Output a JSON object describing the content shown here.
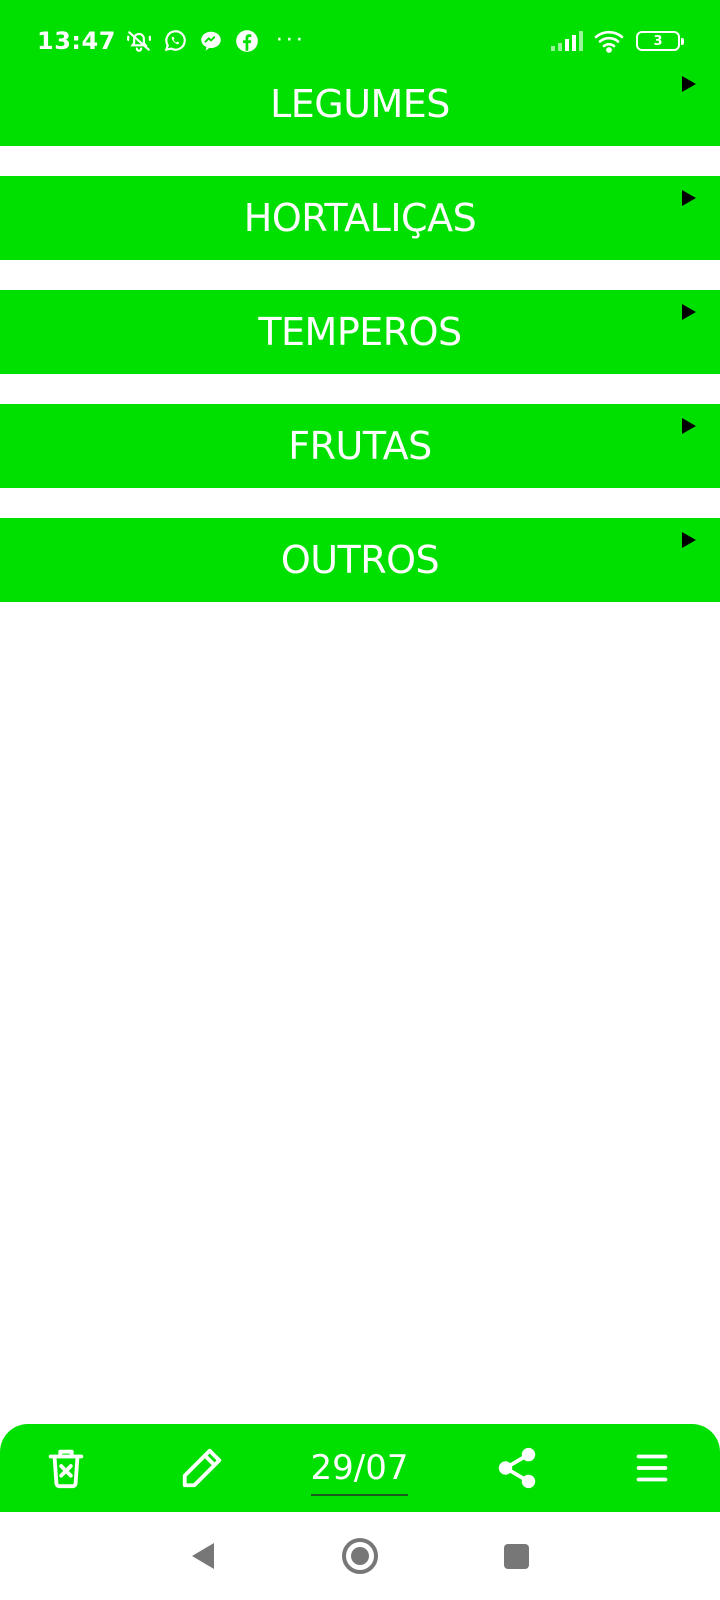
{
  "status_bar": {
    "time": "13:47",
    "left_icons": [
      "notifications-off-icon",
      "whatsapp-icon",
      "messenger-icon",
      "facebook-icon"
    ],
    "more_indicator": "···",
    "right_icons": [
      "signal-icon",
      "wifi-icon"
    ],
    "battery_level": "3"
  },
  "categories": [
    {
      "label": "LEGUMES"
    },
    {
      "label": "HORTALIÇAS"
    },
    {
      "label": "TEMPEROS"
    },
    {
      "label": "FRUTAS"
    },
    {
      "label": "OUTROS"
    }
  ],
  "bottom_bar": {
    "date": "29/07",
    "icons": [
      "trash-icon",
      "pencil-icon",
      "share-icon",
      "menu-icon"
    ]
  },
  "nav_bar": {
    "icons": [
      "back-icon",
      "home-icon",
      "recents-icon"
    ]
  },
  "colors": {
    "accent": "#00e000",
    "text_on_accent": "#ffffff",
    "arrow": "#000000",
    "nav_icon": "#777777"
  }
}
